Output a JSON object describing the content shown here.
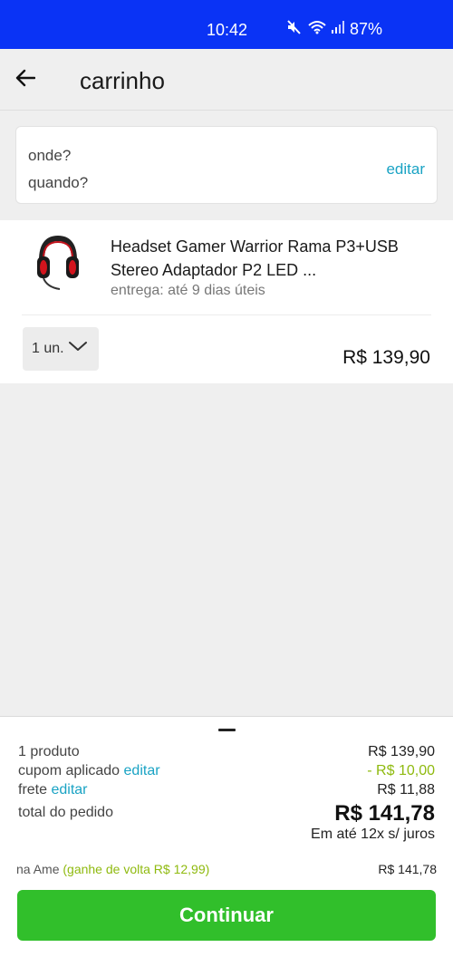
{
  "status_bar": {
    "time": "10:42",
    "battery": "87%",
    "icons": [
      "mute-icon",
      "wifi-icon",
      "signal-icon"
    ],
    "background": "#0a33f5"
  },
  "header": {
    "title": "carrinho",
    "back_icon": "arrow-left-icon"
  },
  "delivery_card": {
    "where_label": "onde?",
    "when_label": "quando?",
    "edit_label": "editar"
  },
  "product": {
    "name": "Headset Gamer Warrior Rama P3+USB Stereo Adaptador P2 LED ...",
    "delivery": "entrega: até 9 dias úteis",
    "quantity": "1 un.",
    "price": "R$ 139,90"
  },
  "summary": {
    "products_label": "1 produto",
    "products_value": "R$ 139,90",
    "coupon_label": "cupom aplicado",
    "coupon_edit": "editar",
    "coupon_value": "- R$ 10,00",
    "shipping_label": "frete",
    "shipping_edit": "editar",
    "shipping_value": "R$ 11,88",
    "total_label": "total do pedido",
    "total_value": "R$ 141,78",
    "installments": "Em até 12x s/ juros",
    "ame_label": "na Ame",
    "ame_cashback": "(ganhe de volta R$ 12,99)",
    "ame_value": "R$ 141,78",
    "continue_label": "Continuar"
  },
  "colors": {
    "link": "#1aa3c4",
    "discount": "#8fba0f",
    "button": "#31bf2b"
  }
}
